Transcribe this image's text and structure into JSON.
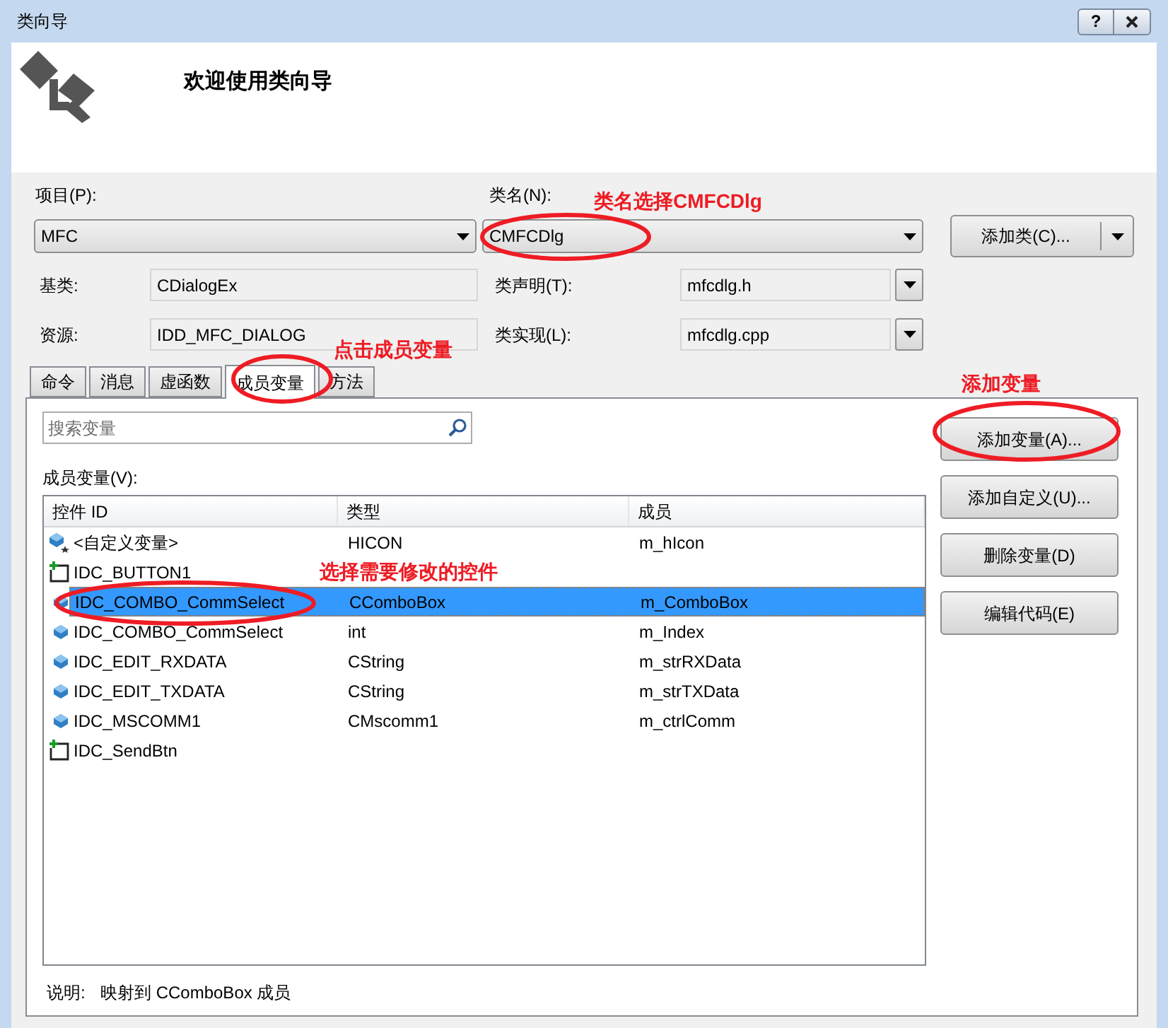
{
  "window": {
    "title": "类向导",
    "help_button": "?"
  },
  "header": {
    "title": "欢迎使用类向导"
  },
  "project": {
    "label": "项目(P):",
    "value": "MFC"
  },
  "class_name": {
    "label": "类名(N):",
    "value": "CMFCDlg"
  },
  "add_class_button": "添加类(C)...",
  "base_class": {
    "label": "基类:",
    "value": "CDialogEx"
  },
  "class_header": {
    "label": "类声明(T):",
    "value": "mfcdlg.h"
  },
  "resource": {
    "label": "资源:",
    "value": "IDD_MFC_DIALOG"
  },
  "class_impl": {
    "label": "类实现(L):",
    "value": "mfcdlg.cpp"
  },
  "tabs": [
    {
      "label": "命令",
      "selected": false
    },
    {
      "label": "消息",
      "selected": false
    },
    {
      "label": "虚函数",
      "selected": false
    },
    {
      "label": "成员变量",
      "selected": true
    },
    {
      "label": "方法",
      "selected": false
    }
  ],
  "search": {
    "placeholder": "搜索变量"
  },
  "members_label": "成员变量(V):",
  "table": {
    "columns": [
      "控件 ID",
      "类型",
      "成员"
    ],
    "rows": [
      {
        "kind": "custom",
        "id": "<自定义变量>",
        "type": "HICON",
        "member": "m_hIcon",
        "selected": false
      },
      {
        "kind": "control",
        "id": "IDC_BUTTON1",
        "selected": false
      },
      {
        "kind": "variable",
        "id": "IDC_COMBO_CommSelect",
        "type": "CComboBox",
        "member": "m_ComboBox",
        "selected": true
      },
      {
        "kind": "variable",
        "id": "IDC_COMBO_CommSelect",
        "type": "int",
        "member": "m_Index",
        "selected": false
      },
      {
        "kind": "variable",
        "id": "IDC_EDIT_RXDATA",
        "type": "CString",
        "member": "m_strRXData",
        "selected": false
      },
      {
        "kind": "variable",
        "id": "IDC_EDIT_TXDATA",
        "type": "CString",
        "member": "m_strTXData",
        "selected": false
      },
      {
        "kind": "variable",
        "id": "IDC_MSCOMM1",
        "type": "CMscomm1",
        "member": "m_ctrlComm",
        "selected": false
      },
      {
        "kind": "control",
        "id": "IDC_SendBtn",
        "selected": false
      }
    ]
  },
  "buttons": [
    "添加变量(A)...",
    "添加自定义(U)...",
    "删除变量(D)",
    "编辑代码(E)"
  ],
  "description": {
    "label": "说明:",
    "value": "映射到 CComboBox 成员"
  },
  "annotations": [
    {
      "text": "类名选择CMFCDlg"
    },
    {
      "text": "点击成员变量"
    },
    {
      "text": "添加变量"
    },
    {
      "text": "选择需要修改的控件"
    }
  ]
}
